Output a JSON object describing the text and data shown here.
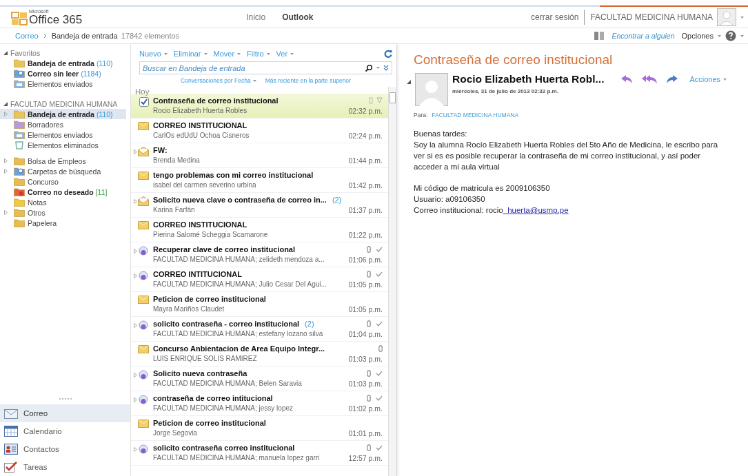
{
  "header": {
    "logo_small": "Microsoft",
    "logo": "Office 365",
    "nav": [
      {
        "label": "Inicio",
        "selected": false
      },
      {
        "label": "Outlook",
        "selected": true
      }
    ],
    "signout": "cerrar sesión",
    "user": "FACULTAD MEDICINA HUMANA"
  },
  "breadcrumb": {
    "root": "Correo",
    "current": "Bandeja de entrada",
    "count": "17842 elementos"
  },
  "tools": {
    "find": "Encontrar a alguien",
    "options": "Opciones"
  },
  "favorites": {
    "title": "Favoritos",
    "groups": [
      {
        "items": [
          {
            "name": "Bandeja de entrada",
            "count": "(110)",
            "kind": "inbox",
            "bold": true,
            "selected": false,
            "expander": false
          },
          {
            "name": "Correo sin leer",
            "count": "(1184)",
            "kind": "search",
            "bold": true,
            "selected": false,
            "expander": false
          },
          {
            "name": "Elementos enviados",
            "kind": "sent",
            "bold": false,
            "selected": false,
            "expander": false
          }
        ]
      }
    ]
  },
  "mailbox": {
    "title": "FACULTAD MEDICINA HUMANA",
    "groups": [
      {
        "items": [
          {
            "name": "Bandeja de entrada",
            "count": "(110)",
            "kind": "inbox",
            "bold": true,
            "selected": true,
            "expander": true
          },
          {
            "name": "Borradores",
            "kind": "drafts",
            "bold": false,
            "selected": false,
            "expander": false
          },
          {
            "name": "Elementos enviados",
            "kind": "sent",
            "bold": false,
            "selected": false,
            "expander": false
          },
          {
            "name": "Elementos eliminados",
            "kind": "deleted",
            "bold": false,
            "selected": false,
            "expander": false
          }
        ]
      },
      {
        "items": [
          {
            "name": "Bolsa de Empleos",
            "kind": "folder",
            "bold": false,
            "selected": false,
            "expander": true
          },
          {
            "name": "Carpetas de búsqueda",
            "kind": "search",
            "bold": false,
            "selected": false,
            "expander": true
          },
          {
            "name": "Concurso",
            "kind": "folder",
            "bold": false,
            "selected": false,
            "expander": false
          },
          {
            "name": "Correo no deseado",
            "count": "[11]",
            "kind": "junk",
            "bold": true,
            "selected": false,
            "expander": false
          },
          {
            "name": "Notas",
            "kind": "notes",
            "bold": false,
            "selected": false,
            "expander": false
          },
          {
            "name": "Otros",
            "kind": "folder",
            "bold": false,
            "selected": false,
            "expander": true
          },
          {
            "name": "Papelera",
            "kind": "folder",
            "bold": false,
            "selected": false,
            "expander": false
          }
        ]
      }
    ]
  },
  "nav_links": [
    {
      "label": "Correo",
      "kind": "mail",
      "selected": true
    },
    {
      "label": "Calendario",
      "kind": "calendar",
      "selected": false
    },
    {
      "label": "Contactos",
      "kind": "contacts",
      "selected": false
    },
    {
      "label": "Tareas",
      "kind": "tasks",
      "selected": false
    }
  ],
  "list": {
    "actions": [
      "Nuevo",
      "Eliminar",
      "Mover",
      "Filtro",
      "Ver"
    ],
    "search": {
      "placeholder": "Buscar en Bandeja de entrada"
    },
    "sort": "Conversaciones por Fecha",
    "order": "Más reciente en la parte superior",
    "group": "Hoy"
  },
  "messages": [
    {
      "subject": "Contraseña de correo institucional",
      "from": "Rocio Elizabeth Huerta Robles",
      "time": "02:32 p.m.",
      "kind": "check",
      "expander": false,
      "attachment": false,
      "replied": false,
      "selected": true
    },
    {
      "subject": "CORREO INSTITUCIONAL",
      "from": "CarlOs edUdU Ochoa Cisneros",
      "time": "02:24 p.m.",
      "kind": "envelope",
      "expander": false,
      "attachment": false,
      "replied": false,
      "selected": false
    },
    {
      "subject": "FW:",
      "from": "Brenda Medina",
      "time": "01:44 p.m.",
      "kind": "open-envelope",
      "expander": true,
      "attachment": false,
      "replied": false,
      "selected": false
    },
    {
      "subject": "tengo problemas con mi correo institucional",
      "from": "isabel del carmen severino urbina",
      "time": "01:42 p.m.",
      "kind": "envelope",
      "expander": false,
      "attachment": false,
      "replied": false,
      "selected": false
    },
    {
      "subject": "Solicito nueva clave o contraseña de correo in...",
      "count": "(2)",
      "from": "Karina Farfán",
      "time": "01:37 p.m.",
      "kind": "open-envelope",
      "expander": true,
      "attachment": false,
      "replied": false,
      "selected": false
    },
    {
      "subject": "CORREO INSTITUCIONAL",
      "from": "Pierina Salomé Scheggia Scamarone",
      "time": "01:22 p.m.",
      "kind": "envelope",
      "expander": false,
      "attachment": false,
      "replied": false,
      "selected": false
    },
    {
      "subject": "Recuperar clave de correo institucional",
      "from": "FACULTAD MEDICINA HUMANA; zelideth mendoza a...",
      "time": "01:06 p.m.",
      "kind": "people",
      "expander": true,
      "attachment": true,
      "replied": true,
      "selected": false
    },
    {
      "subject": "CORREO INTITUCIONAL",
      "from": "FACULTAD MEDICINA HUMANA; Julio Cesar Del Agui...",
      "time": "01:05 p.m.",
      "kind": "people",
      "expander": true,
      "attachment": true,
      "replied": true,
      "selected": false
    },
    {
      "subject": "Peticion de correo institucional",
      "from": "Mayra Mariños Claudet",
      "time": "01:05 p.m.",
      "kind": "envelope",
      "expander": false,
      "attachment": false,
      "replied": false,
      "selected": false
    },
    {
      "subject": "solicito contraseña - correo institucional",
      "count": "(2)",
      "from": "FACULTAD MEDICINA HUMANA; estefany lozano silva",
      "time": "01:04 p.m.",
      "kind": "people",
      "expander": true,
      "attachment": true,
      "replied": true,
      "selected": false
    },
    {
      "subject": "Concurso Anbientacion de Area Equipo Integr...",
      "from": "LUIS ENRIQUE SOLIS RAMIREZ",
      "time": "01:03 p.m.",
      "kind": "envelope",
      "expander": false,
      "attachment": true,
      "replied": false,
      "selected": false
    },
    {
      "subject": "Solicito nueva contraseña",
      "from": "FACULTAD MEDICINA HUMANA; Belen Saravia",
      "time": "01:03 p.m.",
      "kind": "people",
      "expander": true,
      "attachment": true,
      "replied": true,
      "selected": false
    },
    {
      "subject": "contraseña de correo intitucional",
      "from": "FACULTAD MEDICINA HUMANA; jessy lopez",
      "time": "01:02 p.m.",
      "kind": "people",
      "expander": true,
      "attachment": true,
      "replied": true,
      "selected": false
    },
    {
      "subject": "Peticion de correo institucional",
      "from": "Jorge Segovia",
      "time": "01:01 p.m.",
      "kind": "envelope",
      "expander": false,
      "attachment": false,
      "replied": false,
      "selected": false
    },
    {
      "subject": "solicito contraseña correo institucional",
      "from": "FACULTAD MEDICINA HUMANA; manuela lopez garri",
      "time": "12:57 p.m.",
      "kind": "people",
      "expander": true,
      "attachment": true,
      "replied": true,
      "selected": false
    }
  ],
  "reading": {
    "title": "Contraseña de correo institucional",
    "sender": "Rocio Elizabeth Huerta Robl...",
    "date": "miércoles, 31 de julio de 2013 02:32 p.m.",
    "actions": "Acciones",
    "to_label": "Para:",
    "to": "FACULTAD MEDICINA HUMANA",
    "paragraphs": [
      [
        {
          "text": "Buenas tardes:"
        },
        {
          "text": "Soy la alumna Rocío Elizabeth Huerta Robles del 5to Año de Medicina, le escribo para ver si es es posible recuperar la contraseña de mi correo institucional, y así poder acceder a mi aula virtual"
        }
      ],
      [
        {
          "text": "Mi código de matricula es 2009106350"
        },
        {
          "text": "Usuario: a09106350"
        },
        {
          "text": "Correo institucional: rocio",
          "link": "_huerta@usmp.pe"
        }
      ]
    ]
  }
}
